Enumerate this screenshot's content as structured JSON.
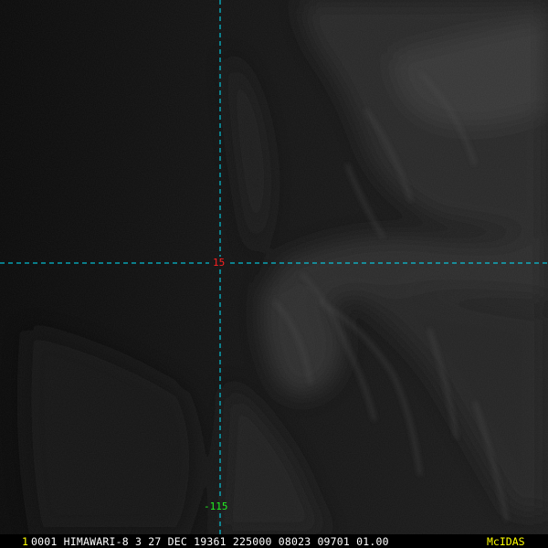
{
  "viewer": {
    "frame_number": "1",
    "frame_info": "0001 HIMAWARI-8   3 27 DEC 19361 225000 08023 09701 01.00",
    "brand": "McIDAS"
  },
  "grid": {
    "latitude_label": "15",
    "longitude_label": "-115"
  },
  "colors": {
    "background": "#0b0b0b",
    "grid_line": "#00e5ff",
    "latitude_label": "#ff2020",
    "longitude_label": "#22ee22",
    "frame_number": "#ffff00",
    "frame_info": "#ffffff",
    "brand": "#ffff00"
  }
}
